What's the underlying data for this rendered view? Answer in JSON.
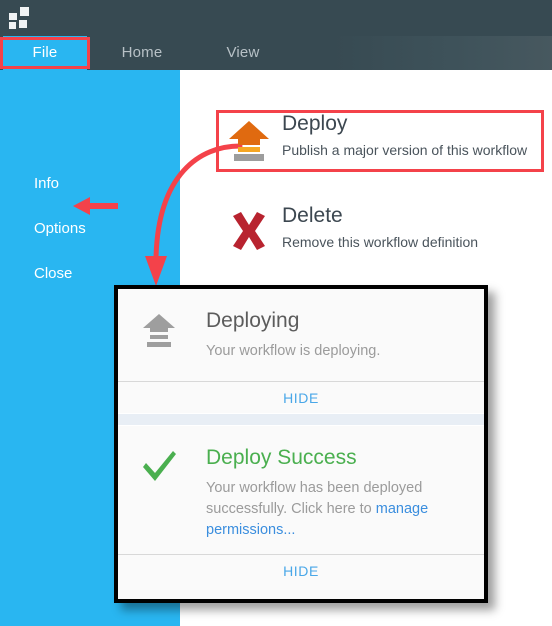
{
  "window": {
    "logo_icon": "app-squares-logo"
  },
  "tabs": [
    {
      "id": "file",
      "label": "File",
      "active": true
    },
    {
      "id": "home",
      "label": "Home",
      "active": false
    },
    {
      "id": "view",
      "label": "View",
      "active": false
    }
  ],
  "sidebar": {
    "items": [
      {
        "id": "info",
        "label": "Info"
      },
      {
        "id": "options",
        "label": "Options"
      },
      {
        "id": "close",
        "label": "Close"
      }
    ]
  },
  "commands": [
    {
      "id": "deploy",
      "title": "Deploy",
      "subtitle": "Publish a major version of this workflow",
      "icon": "deploy-upload-icon",
      "highlighted": true
    },
    {
      "id": "delete",
      "title": "Delete",
      "subtitle": "Remove this workflow definition",
      "icon": "delete-x-icon",
      "highlighted": false
    }
  ],
  "notifications": {
    "deploying": {
      "icon": "deploying-upload-icon",
      "title": "Deploying",
      "text": "Your workflow is deploying.",
      "hide_label": "HIDE"
    },
    "success": {
      "icon": "check-mark-icon",
      "title": "Deploy Success",
      "text_before": "Your workflow has been deployed successfully. Click here to ",
      "link_text": "manage permissions...",
      "hide_label": "HIDE"
    }
  },
  "annotations": {
    "highlight_color": "#f4424a",
    "arrow_to_close": "red-arrow-left",
    "arrow_deploy_to_panel": "red-curved-arrow"
  },
  "colors": {
    "accent_blue": "#29b6f1",
    "header_dark": "#374a52",
    "deploy_orange": "#e06a10",
    "delete_red": "#b8232f",
    "success_green": "#4aaf4f",
    "link_blue": "#3b8ede"
  }
}
